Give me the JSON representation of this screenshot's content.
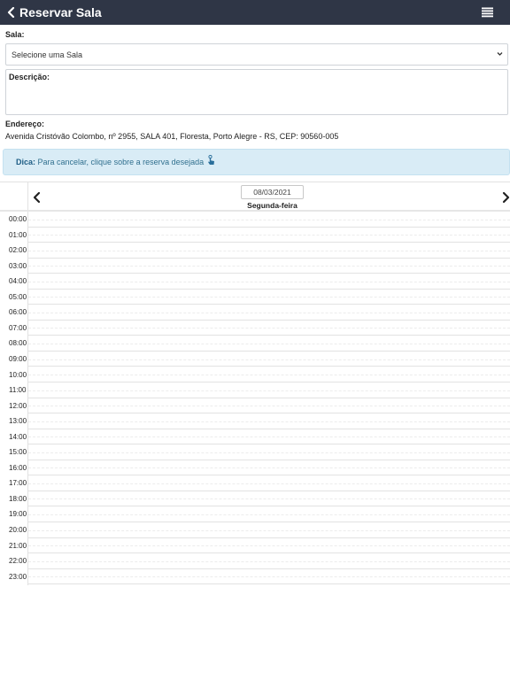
{
  "header": {
    "title": "Reservar Sala",
    "back_icon": "chevron-left-icon",
    "menu_icon": "hamburger-menu-icon",
    "bg_color": "#2f3646"
  },
  "form": {
    "sala_label": "Sala:",
    "sala_select_value": "Selecione uma Sala",
    "descricao_label": "Descrição:",
    "endereco_label": "Endereço:",
    "endereco_value": "Avenida Cristóvão Colombo, nº 2955, SALA 401, Floresta, Porto Alegre - RS, CEP: 90560-005"
  },
  "tip": {
    "bold": "Dica:",
    "text": " Para cancelar, clique sobre a reserva desejada",
    "icon": "tap-hand-icon",
    "bg_color": "#d9ecf6"
  },
  "calendar": {
    "date": "08/03/2021",
    "day_name": "Segunda-feira",
    "prev_icon": "chevron-left-icon",
    "next_icon": "chevron-right-icon",
    "hours": [
      "00:00",
      "01:00",
      "02:00",
      "03:00",
      "04:00",
      "05:00",
      "06:00",
      "07:00",
      "08:00",
      "09:00",
      "10:00",
      "11:00",
      "12:00",
      "13:00",
      "14:00",
      "15:00",
      "16:00",
      "17:00",
      "18:00",
      "19:00",
      "20:00",
      "21:00",
      "22:00",
      "23:00"
    ]
  }
}
